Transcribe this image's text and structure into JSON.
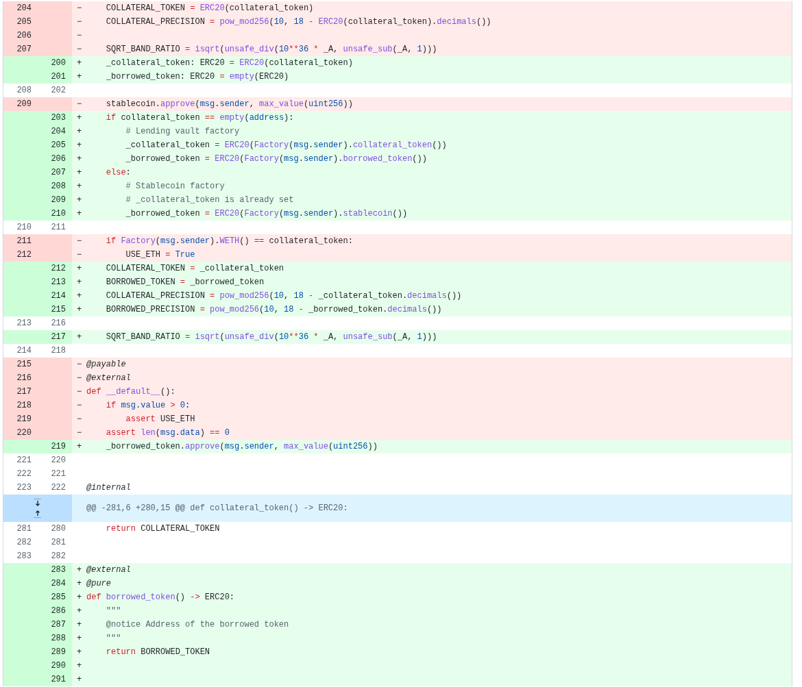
{
  "rows": [
    {
      "kind": "deletion",
      "old": "204",
      "sign": "−",
      "tokens": [
        "    COLLATERAL_TOKEN ",
        {
          "kind": "keyword",
          "text": "= "
        },
        {
          "kind": "function",
          "text": "ERC20"
        },
        "(collateral_token)"
      ]
    },
    {
      "kind": "deletion",
      "old": "205",
      "sign": "−",
      "tokens": [
        "    COLLATERAL_PRECISION ",
        {
          "kind": "keyword",
          "text": "= "
        },
        {
          "kind": "function",
          "text": "pow_mod256"
        },
        "(",
        {
          "kind": "constant",
          "text": "10"
        },
        ", ",
        {
          "kind": "constant",
          "text": "18 "
        },
        {
          "kind": "keyword",
          "text": "- "
        },
        {
          "kind": "function",
          "text": "ERC20"
        },
        "(collateral_token).",
        {
          "kind": "function",
          "text": "decimals"
        },
        "())"
      ]
    },
    {
      "kind": "deletion",
      "old": "206",
      "sign": "−"
    },
    {
      "kind": "deletion",
      "old": "207",
      "sign": "−",
      "tokens": [
        "    SQRT_BAND_RATIO ",
        {
          "kind": "keyword",
          "text": "= "
        },
        {
          "kind": "function",
          "text": "isqrt"
        },
        "(",
        {
          "kind": "function",
          "text": "unsafe_div"
        },
        "(",
        {
          "kind": "constant",
          "text": "10"
        },
        {
          "kind": "keyword",
          "text": "**"
        },
        {
          "kind": "constant",
          "text": "36 "
        },
        {
          "kind": "keyword",
          "text": "*"
        },
        " _A, ",
        {
          "kind": "function",
          "text": "unsafe_sub"
        },
        "(_A, ",
        {
          "kind": "constant",
          "text": "1"
        },
        ")))"
      ]
    },
    {
      "kind": "addition",
      "new": "200",
      "sign": "+",
      "tokens": [
        "    _collateral_token: ERC20 ",
        {
          "kind": "keyword",
          "text": "= "
        },
        {
          "kind": "function",
          "text": "ERC20"
        },
        "(collateral_token)"
      ]
    },
    {
      "kind": "addition",
      "new": "201",
      "sign": "+",
      "tokens": [
        "    _borrowed_token: ERC20 ",
        {
          "kind": "keyword",
          "text": "= "
        },
        {
          "kind": "function",
          "text": "empty"
        },
        "(ERC20)"
      ]
    },
    {
      "kind": "context",
      "old": "208",
      "new": "202"
    },
    {
      "kind": "deletion",
      "old": "209",
      "sign": "−",
      "tokens": [
        "    stablecoin.",
        {
          "kind": "function",
          "text": "approve"
        },
        "(",
        {
          "kind": "constant",
          "text": "msg"
        },
        ".",
        {
          "kind": "constant",
          "text": "sender"
        },
        ", ",
        {
          "kind": "function",
          "text": "max_value"
        },
        "(",
        {
          "kind": "constant",
          "text": "uint256"
        },
        "))"
      ]
    },
    {
      "kind": "addition",
      "new": "203",
      "sign": "+",
      "tokens": [
        {
          "kind": "keyword",
          "text": "    if"
        },
        " collateral_token ",
        {
          "kind": "keyword",
          "text": "== "
        },
        {
          "kind": "function",
          "text": "empty"
        },
        "(",
        {
          "kind": "constant",
          "text": "address"
        },
        "):"
      ]
    },
    {
      "kind": "addition",
      "new": "204",
      "sign": "+",
      "tokens": [
        {
          "kind": "comment",
          "text": "        # Lending vault factory"
        }
      ]
    },
    {
      "kind": "addition",
      "new": "205",
      "sign": "+",
      "tokens": [
        "        _collateral_token ",
        {
          "kind": "keyword",
          "text": "= "
        },
        {
          "kind": "function",
          "text": "ERC20"
        },
        "(",
        {
          "kind": "function",
          "text": "Factory"
        },
        "(",
        {
          "kind": "constant",
          "text": "msg"
        },
        ".",
        {
          "kind": "constant",
          "text": "sender"
        },
        ").",
        {
          "kind": "function",
          "text": "collateral_token"
        },
        "())"
      ]
    },
    {
      "kind": "addition",
      "new": "206",
      "sign": "+",
      "tokens": [
        "        _borrowed_token ",
        {
          "kind": "keyword",
          "text": "= "
        },
        {
          "kind": "function",
          "text": "ERC20"
        },
        "(",
        {
          "kind": "function",
          "text": "Factory"
        },
        "(",
        {
          "kind": "constant",
          "text": "msg"
        },
        ".",
        {
          "kind": "constant",
          "text": "sender"
        },
        ").",
        {
          "kind": "function",
          "text": "borrowed_token"
        },
        "())"
      ]
    },
    {
      "kind": "addition",
      "new": "207",
      "sign": "+",
      "tokens": [
        {
          "kind": "keyword",
          "text": "    else"
        },
        ":"
      ]
    },
    {
      "kind": "addition",
      "new": "208",
      "sign": "+",
      "tokens": [
        {
          "kind": "comment",
          "text": "        # Stablecoin factory"
        }
      ]
    },
    {
      "kind": "addition",
      "new": "209",
      "sign": "+",
      "tokens": [
        {
          "kind": "comment",
          "text": "        # _collateral_token is already set"
        }
      ]
    },
    {
      "kind": "addition",
      "new": "210",
      "sign": "+",
      "tokens": [
        "        _borrowed_token ",
        {
          "kind": "keyword",
          "text": "= "
        },
        {
          "kind": "function",
          "text": "ERC20"
        },
        "(",
        {
          "kind": "function",
          "text": "Factory"
        },
        "(",
        {
          "kind": "constant",
          "text": "msg"
        },
        ".",
        {
          "kind": "constant",
          "text": "sender"
        },
        ").",
        {
          "kind": "function",
          "text": "stablecoin"
        },
        "())"
      ]
    },
    {
      "kind": "context",
      "old": "210",
      "new": "211"
    },
    {
      "kind": "deletion",
      "old": "211",
      "sign": "−",
      "tokens": [
        {
          "kind": "keyword",
          "text": "    if "
        },
        {
          "kind": "function",
          "text": "Factory"
        },
        "(",
        {
          "kind": "constant",
          "text": "msg"
        },
        ".",
        {
          "kind": "constant",
          "text": "sender"
        },
        ").",
        {
          "kind": "function",
          "text": "WETH"
        },
        "() ",
        {
          "kind": "keyword",
          "text": "=="
        },
        " collateral_token:"
      ]
    },
    {
      "kind": "deletion",
      "old": "212",
      "sign": "−",
      "tokens": [
        "        USE_ETH ",
        {
          "kind": "keyword",
          "text": "= "
        },
        {
          "kind": "constant",
          "text": "True"
        }
      ]
    },
    {
      "kind": "addition",
      "new": "212",
      "sign": "+",
      "tokens": [
        "    COLLATERAL_TOKEN ",
        {
          "kind": "keyword",
          "text": "="
        },
        " _collateral_token"
      ]
    },
    {
      "kind": "addition",
      "new": "213",
      "sign": "+",
      "tokens": [
        "    BORROWED_TOKEN ",
        {
          "kind": "keyword",
          "text": "="
        },
        " _borrowed_token"
      ]
    },
    {
      "kind": "addition",
      "new": "214",
      "sign": "+",
      "tokens": [
        "    COLLATERAL_PRECISION ",
        {
          "kind": "keyword",
          "text": "= "
        },
        {
          "kind": "function",
          "text": "pow_mod256"
        },
        "(",
        {
          "kind": "constant",
          "text": "10"
        },
        ", ",
        {
          "kind": "constant",
          "text": "18 "
        },
        {
          "kind": "keyword",
          "text": "-"
        },
        " _collateral_token.",
        {
          "kind": "function",
          "text": "decimals"
        },
        "())"
      ]
    },
    {
      "kind": "addition",
      "new": "215",
      "sign": "+",
      "tokens": [
        "    BORROWED_PRECISION ",
        {
          "kind": "keyword",
          "text": "= "
        },
        {
          "kind": "function",
          "text": "pow_mod256"
        },
        "(",
        {
          "kind": "constant",
          "text": "10"
        },
        ", ",
        {
          "kind": "constant",
          "text": "18 "
        },
        {
          "kind": "keyword",
          "text": "-"
        },
        " _borrowed_token.",
        {
          "kind": "function",
          "text": "decimals"
        },
        "())"
      ]
    },
    {
      "kind": "context",
      "old": "213",
      "new": "216"
    },
    {
      "kind": "addition",
      "new": "217",
      "sign": "+",
      "tokens": [
        "    SQRT_BAND_RATIO ",
        {
          "kind": "keyword",
          "text": "= "
        },
        {
          "kind": "function",
          "text": "isqrt"
        },
        "(",
        {
          "kind": "function",
          "text": "unsafe_div"
        },
        "(",
        {
          "kind": "constant",
          "text": "10"
        },
        {
          "kind": "keyword",
          "text": "**"
        },
        {
          "kind": "constant",
          "text": "36 "
        },
        {
          "kind": "keyword",
          "text": "*"
        },
        " _A, ",
        {
          "kind": "function",
          "text": "unsafe_sub"
        },
        "(_A, ",
        {
          "kind": "constant",
          "text": "1"
        },
        ")))"
      ]
    },
    {
      "kind": "context",
      "old": "214",
      "new": "218"
    },
    {
      "kind": "deletion",
      "old": "215",
      "sign": "−",
      "tokens": [
        {
          "kind": "decorator",
          "text": "@payable"
        }
      ]
    },
    {
      "kind": "deletion",
      "old": "216",
      "sign": "−",
      "tokens": [
        {
          "kind": "decorator",
          "text": "@external"
        }
      ]
    },
    {
      "kind": "deletion",
      "old": "217",
      "sign": "−",
      "tokens": [
        {
          "kind": "keyword",
          "text": "def "
        },
        {
          "kind": "function",
          "text": "__default__"
        },
        "():"
      ]
    },
    {
      "kind": "deletion",
      "old": "218",
      "sign": "−",
      "tokens": [
        {
          "kind": "keyword",
          "text": "    if "
        },
        {
          "kind": "constant",
          "text": "msg"
        },
        ".",
        {
          "kind": "constant",
          "text": "value "
        },
        {
          "kind": "keyword",
          "text": "> "
        },
        {
          "kind": "constant",
          "text": "0"
        },
        ":"
      ]
    },
    {
      "kind": "deletion",
      "old": "219",
      "sign": "−",
      "tokens": [
        {
          "kind": "keyword",
          "text": "        assert"
        },
        " USE_ETH"
      ]
    },
    {
      "kind": "deletion",
      "old": "220",
      "sign": "−",
      "tokens": [
        {
          "kind": "keyword",
          "text": "    assert "
        },
        {
          "kind": "function",
          "text": "len"
        },
        "(",
        {
          "kind": "constant",
          "text": "msg"
        },
        ".",
        {
          "kind": "constant",
          "text": "data"
        },
        ") ",
        {
          "kind": "keyword",
          "text": "== "
        },
        {
          "kind": "constant",
          "text": "0"
        }
      ]
    },
    {
      "kind": "addition",
      "new": "219",
      "sign": "+",
      "tokens": [
        "    _borrowed_token.",
        {
          "kind": "function",
          "text": "approve"
        },
        "(",
        {
          "kind": "constant",
          "text": "msg"
        },
        ".",
        {
          "kind": "constant",
          "text": "sender"
        },
        ", ",
        {
          "kind": "function",
          "text": "max_value"
        },
        "(",
        {
          "kind": "constant",
          "text": "uint256"
        },
        "))"
      ]
    },
    {
      "kind": "context",
      "old": "221",
      "new": "220"
    },
    {
      "kind": "context",
      "old": "222",
      "new": "221"
    },
    {
      "kind": "context",
      "old": "223",
      "new": "222",
      "tokens": [
        {
          "kind": "decorator",
          "text": "@internal"
        }
      ]
    },
    {
      "kind": "hunk",
      "header": "@@ -281,6 +280,15 @@ def collateral_token() -> ERC20:"
    },
    {
      "kind": "context",
      "old": "281",
      "new": "280",
      "tokens": [
        {
          "kind": "keyword",
          "text": "    return"
        },
        " COLLATERAL_TOKEN"
      ]
    },
    {
      "kind": "context",
      "old": "282",
      "new": "281"
    },
    {
      "kind": "context",
      "old": "283",
      "new": "282"
    },
    {
      "kind": "addition",
      "new": "283",
      "sign": "+",
      "tokens": [
        {
          "kind": "decorator",
          "text": "@external"
        }
      ]
    },
    {
      "kind": "addition",
      "new": "284",
      "sign": "+",
      "tokens": [
        {
          "kind": "decorator",
          "text": "@pure"
        }
      ]
    },
    {
      "kind": "addition",
      "new": "285",
      "sign": "+",
      "tokens": [
        {
          "kind": "keyword",
          "text": "def "
        },
        {
          "kind": "function",
          "text": "borrowed_token"
        },
        "() ",
        {
          "kind": "keyword",
          "text": "->"
        },
        " ERC20:"
      ]
    },
    {
      "kind": "addition",
      "new": "286",
      "sign": "+",
      "tokens": [
        {
          "kind": "comment",
          "text": "    \"\"\""
        }
      ]
    },
    {
      "kind": "addition",
      "new": "287",
      "sign": "+",
      "tokens": [
        {
          "kind": "comment",
          "text": "    @notice Address of the borrowed token"
        }
      ]
    },
    {
      "kind": "addition",
      "new": "288",
      "sign": "+",
      "tokens": [
        {
          "kind": "comment",
          "text": "    \"\"\""
        }
      ]
    },
    {
      "kind": "addition",
      "new": "289",
      "sign": "+",
      "tokens": [
        {
          "kind": "keyword",
          "text": "    return"
        },
        " BORROWED_TOKEN"
      ]
    },
    {
      "kind": "addition",
      "new": "290",
      "sign": "+"
    },
    {
      "kind": "addition",
      "new": "291",
      "sign": "+"
    }
  ]
}
